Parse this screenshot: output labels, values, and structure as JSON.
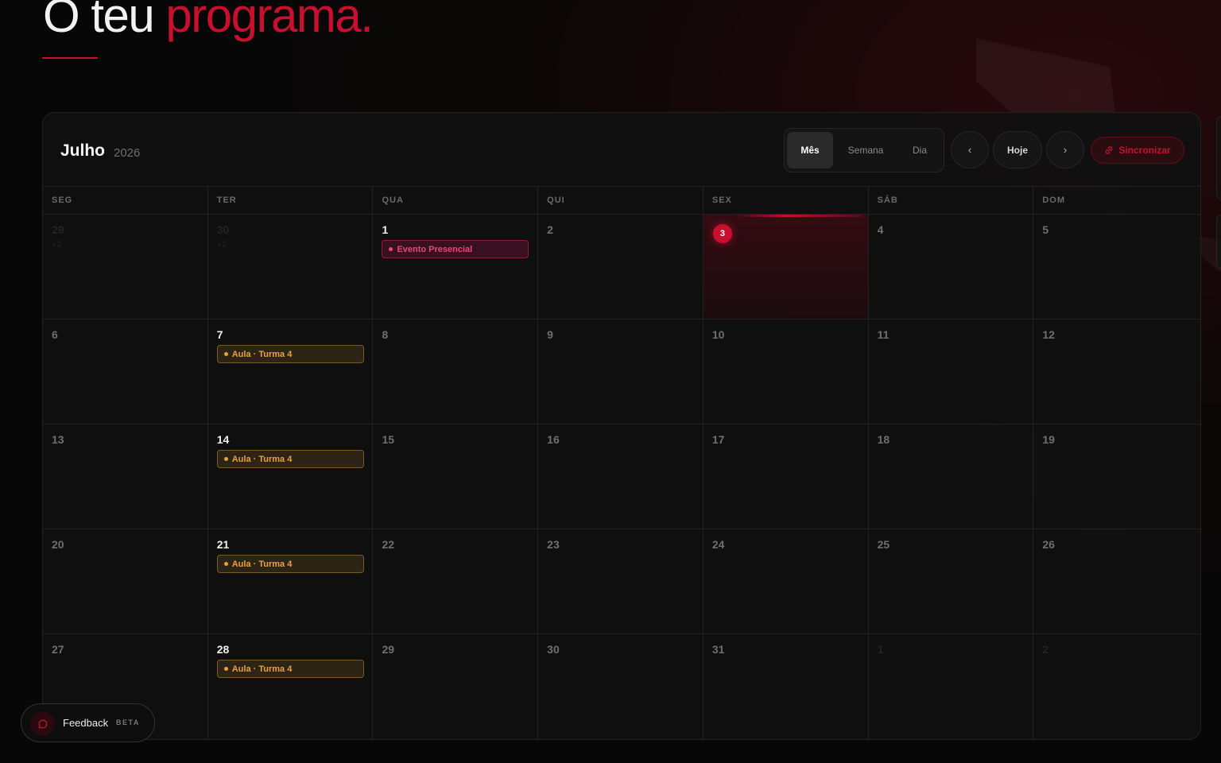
{
  "page": {
    "title_part1": "O teu",
    "title_part2": "programa.",
    "accent_color": "#c8102e"
  },
  "calendar": {
    "month": "Julho",
    "year": "2026",
    "views": {
      "month": "Mês",
      "week": "Semana",
      "day": "Dia",
      "active": "Mês"
    },
    "nav": {
      "prev": "‹",
      "today": "Hoje",
      "next": "›"
    },
    "sync_label": "Sincronizar",
    "weekdays": [
      "SEG",
      "TER",
      "QUA",
      "QUI",
      "SEX",
      "SÁB",
      "DOM"
    ],
    "weeks": [
      [
        {
          "num": "29",
          "other": true,
          "sub": "+2"
        },
        {
          "num": "30",
          "other": true,
          "sub": "+2"
        },
        {
          "num": "1",
          "bright": true,
          "events": [
            {
              "label": "Evento Presencial",
              "kind": "pink"
            }
          ]
        },
        {
          "num": "2"
        },
        {
          "num": "3",
          "today": true
        },
        {
          "num": "4"
        },
        {
          "num": "5"
        }
      ],
      [
        {
          "num": "6"
        },
        {
          "num": "7",
          "bright": true,
          "events": [
            {
              "label": "Aula · Turma 4",
              "kind": "amber"
            }
          ]
        },
        {
          "num": "8"
        },
        {
          "num": "9"
        },
        {
          "num": "10"
        },
        {
          "num": "11"
        },
        {
          "num": "12"
        }
      ],
      [
        {
          "num": "13"
        },
        {
          "num": "14",
          "bright": true,
          "events": [
            {
              "label": "Aula · Turma 4",
              "kind": "amber"
            }
          ]
        },
        {
          "num": "15"
        },
        {
          "num": "16"
        },
        {
          "num": "17"
        },
        {
          "num": "18"
        },
        {
          "num": "19"
        }
      ],
      [
        {
          "num": "20"
        },
        {
          "num": "21",
          "bright": true,
          "events": [
            {
              "label": "Aula · Turma 4",
              "kind": "amber"
            }
          ]
        },
        {
          "num": "22"
        },
        {
          "num": "23"
        },
        {
          "num": "24"
        },
        {
          "num": "25"
        },
        {
          "num": "26"
        }
      ],
      [
        {
          "num": "27"
        },
        {
          "num": "28",
          "bright": true,
          "events": [
            {
              "label": "Aula · Turma 4",
              "kind": "amber"
            }
          ]
        },
        {
          "num": "29"
        },
        {
          "num": "30"
        },
        {
          "num": "31"
        },
        {
          "num": "1",
          "other": true
        },
        {
          "num": "2",
          "other": true
        }
      ]
    ]
  },
  "feedback": {
    "label": "Feedback",
    "badge": "BETA",
    "icon": "chat-bubble-icon"
  },
  "icons": {
    "sync": "link-icon"
  }
}
